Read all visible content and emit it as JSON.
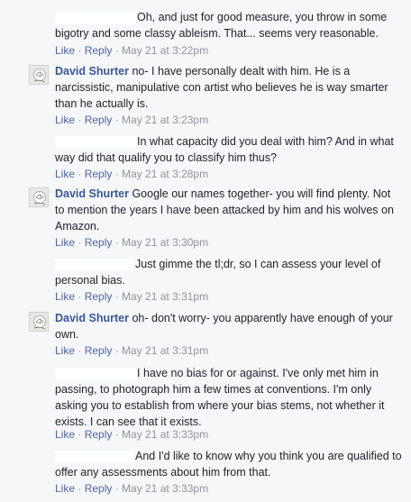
{
  "comments": [
    {
      "author": "",
      "text": "Oh, and just for good measure, you throw in some bigotry and some classy ableism. That... seems very reasonable.",
      "like": "Like",
      "reply": "Reply",
      "sep": " · ",
      "time": "May 21 at 3:22pm"
    },
    {
      "author": "David Shurter",
      "text": "no- I have personally dealt with him. He is a narcissistic, manipulative con artist who believes he is way smarter than he actually is.",
      "like": "Like",
      "reply": "Reply",
      "sep": " · ",
      "time": "May 21 at 3:23pm"
    },
    {
      "author": "",
      "text": "In what capacity did you deal with him? And in what way did that qualify you to classify him thus?",
      "like": "Like",
      "reply": "Reply",
      "sep": " · ",
      "time": "May 21 at 3:28pm"
    },
    {
      "author": "David Shurter",
      "text": "Google our names together- you will find plenty. Not to mention the years I have been attacked by him and his wolves on Amazon.",
      "like": "Like",
      "reply": "Reply",
      "sep": " · ",
      "time": "May 21 at 3:30pm"
    },
    {
      "author": "",
      "text": "Just gimme the tl;dr, so I can assess your level of personal bias.",
      "like": "Like",
      "reply": "Reply",
      "sep": " · ",
      "time": "May 21 at 3:31pm"
    },
    {
      "author": "David Shurter",
      "text": "oh- don't worry- you apparently have enough of your own.",
      "like": "Like",
      "reply": "Reply",
      "sep": " · ",
      "time": "May 21 at 3:31pm"
    },
    {
      "author": "",
      "text": "I have no bias for or against. I've only met him in passing, to photograph him a few times at conventions. I'm only asking you to establish from where your bias stems, not whether it exists. I can see that it exists.",
      "like": "Like",
      "reply": "Reply",
      "sep": " · ",
      "time": "May 21 at 3:33pm"
    },
    {
      "author": "",
      "text": "And I'd like to know why you think you are qualified to offer any assessments about him from that.",
      "like": "Like",
      "reply": "Reply",
      "sep": " · ",
      "time": "May 21 at 3:33pm"
    }
  ]
}
